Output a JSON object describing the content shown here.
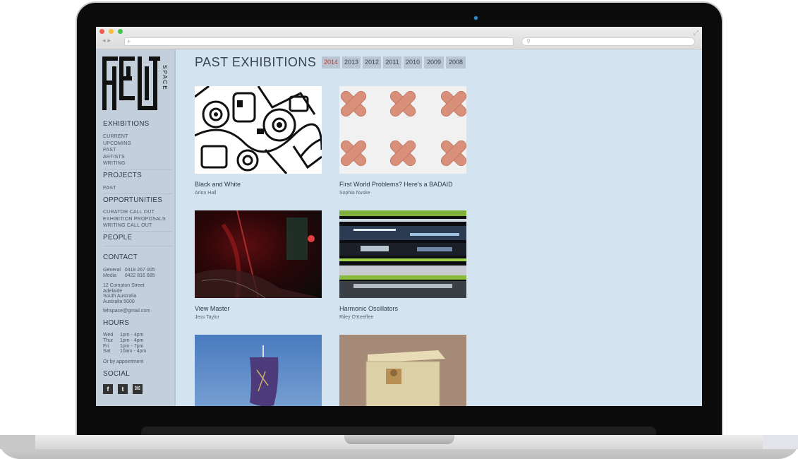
{
  "sidebar": {
    "logo_text": "FELT SPACE",
    "sections": {
      "exhibitions": {
        "heading": "EXHIBITIONS",
        "links": [
          "CURRENT",
          "UPCOMING",
          "PAST",
          "ARTISTS",
          "WRITING"
        ]
      },
      "projects": {
        "heading": "PROJECTS",
        "links": [
          "PAST"
        ]
      },
      "opportunities": {
        "heading": "OPPORTUNITIES",
        "links": [
          "CURATOR CALL OUT",
          "EXHIBITION PROPOSALS",
          "WRITING CALL OUT"
        ]
      },
      "people": {
        "heading": "PEOPLE"
      },
      "contact": {
        "heading": "CONTACT",
        "phones": [
          {
            "label": "General",
            "number": "0418 267 005"
          },
          {
            "label": "Media",
            "number": "0422 816 685"
          }
        ],
        "address": [
          "12 Compton Street",
          "Adelaide",
          "South Australia",
          "Australia 5000"
        ],
        "email": "feltspace@gmail.com"
      },
      "hours": {
        "heading": "HOURS",
        "rows": [
          {
            "day": "Wed",
            "time": "1pm - 4pm"
          },
          {
            "day": "Thur",
            "time": "1pm - 4pm"
          },
          {
            "day": "Fri",
            "time": "1pm - 7pm"
          },
          {
            "day": "Sat",
            "time": "10am - 4pm"
          }
        ],
        "note": "Or by appointment"
      },
      "social": {
        "heading": "SOCIAL",
        "icons": [
          "facebook-icon",
          "twitter-icon",
          "mail-icon"
        ]
      }
    }
  },
  "main": {
    "title": "PAST EXHIBITIONS",
    "years": [
      "2014",
      "2013",
      "2012",
      "2011",
      "2010",
      "2009",
      "2008"
    ],
    "active_year": "2014",
    "exhibitions": [
      {
        "title": "Black and White",
        "artist": "Arlon Hall"
      },
      {
        "title": "First World Problems? Here's a BADAID",
        "artist": "Sophia Nuske"
      },
      {
        "title": "View Master",
        "artist": "Jess Taylor"
      },
      {
        "title": "Harmonic Oscillators",
        "artist": "Riley O'Keeffee"
      },
      {
        "title": "",
        "artist": ""
      },
      {
        "title": "",
        "artist": ""
      }
    ]
  },
  "colors": {
    "page_bg": "#d4e3f0",
    "sidebar_bg": "#c3cfdb",
    "active_year": "#c0392b"
  }
}
